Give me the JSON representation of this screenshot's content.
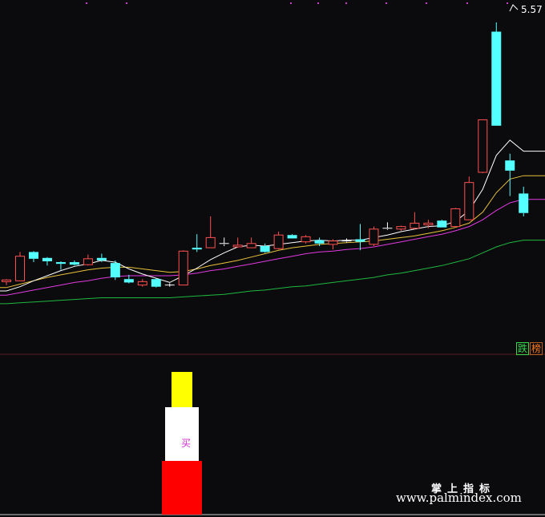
{
  "chart_data": {
    "type": "candlestick",
    "price_range": [
      2.05,
      5.72
    ],
    "high_label": "5.57",
    "candles": [
      {
        "o": 2.51,
        "c": 2.53,
        "h": 2.54,
        "l": 2.47
      },
      {
        "o": 2.52,
        "c": 2.81,
        "h": 2.86,
        "l": 2.52
      },
      {
        "o": 2.86,
        "c": 2.78,
        "h": 2.87,
        "l": 2.74
      },
      {
        "o": 2.79,
        "c": 2.75,
        "h": 2.8,
        "l": 2.7
      },
      {
        "o": 2.74,
        "c": 2.72,
        "h": 2.75,
        "l": 2.65
      },
      {
        "o": 2.74,
        "c": 2.71,
        "h": 2.76,
        "l": 2.7
      },
      {
        "o": 2.71,
        "c": 2.78,
        "h": 2.83,
        "l": 2.7
      },
      {
        "o": 2.79,
        "c": 2.76,
        "h": 2.84,
        "l": 2.74
      },
      {
        "o": 2.73,
        "c": 2.56,
        "h": 2.76,
        "l": 2.53
      },
      {
        "o": 2.54,
        "c": 2.5,
        "h": 2.59,
        "l": 2.49
      },
      {
        "o": 2.47,
        "c": 2.51,
        "h": 2.54,
        "l": 2.45
      },
      {
        "o": 2.54,
        "c": 2.45,
        "h": 2.55,
        "l": 2.44
      },
      {
        "o": 2.47,
        "c": 2.47,
        "h": 2.49,
        "l": 2.45
      },
      {
        "o": 2.47,
        "c": 2.87,
        "h": 2.88,
        "l": 2.47
      },
      {
        "o": 2.91,
        "c": 2.89,
        "h": 3.07,
        "l": 2.86
      },
      {
        "o": 2.91,
        "c": 3.03,
        "h": 3.28,
        "l": 2.91
      },
      {
        "o": 2.96,
        "c": 2.95,
        "h": 3.03,
        "l": 2.93
      },
      {
        "o": 2.92,
        "c": 2.94,
        "h": 3.03,
        "l": 2.91
      },
      {
        "o": 2.91,
        "c": 2.96,
        "h": 3.03,
        "l": 2.91
      },
      {
        "o": 2.93,
        "c": 2.86,
        "h": 2.96,
        "l": 2.85
      },
      {
        "o": 2.9,
        "c": 3.06,
        "h": 3.1,
        "l": 2.89
      },
      {
        "o": 3.06,
        "c": 3.02,
        "h": 3.07,
        "l": 3.02
      },
      {
        "o": 2.98,
        "c": 3.04,
        "h": 3.06,
        "l": 2.96
      },
      {
        "o": 3.0,
        "c": 2.96,
        "h": 3.03,
        "l": 2.93
      },
      {
        "o": 2.95,
        "c": 2.99,
        "h": 3.01,
        "l": 2.89
      },
      {
        "o": 2.98,
        "c": 2.99,
        "h": 3.02,
        "l": 2.97
      },
      {
        "o": 3.01,
        "c": 2.98,
        "h": 3.19,
        "l": 2.88
      },
      {
        "o": 2.95,
        "c": 3.13,
        "h": 3.16,
        "l": 2.93
      },
      {
        "o": 3.13,
        "c": 3.14,
        "h": 3.21,
        "l": 3.12
      },
      {
        "o": 3.13,
        "c": 3.16,
        "h": 3.17,
        "l": 3.11
      },
      {
        "o": 3.14,
        "c": 3.2,
        "h": 3.33,
        "l": 3.13
      },
      {
        "o": 3.18,
        "c": 3.2,
        "h": 3.24,
        "l": 3.14
      },
      {
        "o": 3.23,
        "c": 3.15,
        "h": 3.24,
        "l": 3.15
      },
      {
        "o": 3.16,
        "c": 3.37,
        "h": 3.38,
        "l": 3.15
      },
      {
        "o": 3.24,
        "c": 3.68,
        "h": 3.75,
        "l": 3.24
      },
      {
        "o": 3.8,
        "c": 4.42,
        "h": 4.42,
        "l": 3.79
      },
      {
        "o": 5.46,
        "c": 4.35,
        "h": 5.57,
        "l": 4.35
      },
      {
        "o": 3.94,
        "c": 3.82,
        "h": 4.02,
        "l": 3.52
      },
      {
        "o": 3.55,
        "c": 3.32,
        "h": 3.63,
        "l": 3.28
      }
    ],
    "ma_white": [
      2.4,
      2.45,
      2.52,
      2.58,
      2.64,
      2.69,
      2.72,
      2.76,
      2.74,
      2.66,
      2.6,
      2.55,
      2.5,
      2.58,
      2.67,
      2.77,
      2.85,
      2.92,
      2.94,
      2.93,
      2.95,
      2.97,
      2.99,
      3.0,
      2.99,
      3.0,
      3.0,
      3.03,
      3.06,
      3.1,
      3.13,
      3.16,
      3.17,
      3.22,
      3.35,
      3.6,
      4.0,
      4.18,
      4.05
    ],
    "ma_yellow": [
      2.44,
      2.48,
      2.52,
      2.56,
      2.59,
      2.62,
      2.65,
      2.67,
      2.68,
      2.68,
      2.66,
      2.64,
      2.62,
      2.63,
      2.66,
      2.7,
      2.73,
      2.76,
      2.8,
      2.84,
      2.88,
      2.91,
      2.93,
      2.95,
      2.96,
      2.97,
      2.98,
      2.99,
      3.01,
      3.03,
      3.05,
      3.08,
      3.11,
      3.15,
      3.2,
      3.33,
      3.56,
      3.72,
      3.76
    ],
    "ma_magenta": [
      2.35,
      2.38,
      2.41,
      2.44,
      2.47,
      2.5,
      2.52,
      2.55,
      2.57,
      2.58,
      2.58,
      2.58,
      2.58,
      2.59,
      2.61,
      2.64,
      2.66,
      2.69,
      2.72,
      2.75,
      2.78,
      2.81,
      2.84,
      2.86,
      2.87,
      2.89,
      2.9,
      2.92,
      2.95,
      2.98,
      3.01,
      3.04,
      3.07,
      3.11,
      3.16,
      3.24,
      3.35,
      3.44,
      3.48
    ],
    "ma_green": [
      2.25,
      2.26,
      2.27,
      2.28,
      2.29,
      2.3,
      2.31,
      2.32,
      2.32,
      2.32,
      2.32,
      2.32,
      2.32,
      2.33,
      2.34,
      2.35,
      2.36,
      2.38,
      2.4,
      2.41,
      2.43,
      2.45,
      2.46,
      2.48,
      2.5,
      2.52,
      2.54,
      2.56,
      2.59,
      2.61,
      2.64,
      2.67,
      2.7,
      2.74,
      2.78,
      2.85,
      2.92,
      2.97,
      3.0
    ]
  },
  "indicator": {
    "buy_label": "买",
    "bar_colors": [
      "#ff0000",
      "#ffffff",
      "#ffff00"
    ]
  },
  "tags": {
    "die": "跌",
    "bang": "榜"
  },
  "brand": {
    "cn": "掌上指标",
    "url": "www.palmindex.com"
  },
  "colors": {
    "up": "#ff5050",
    "down": "#54ffff",
    "doji": "#ffffff",
    "ma_white": "#ffffff",
    "ma_yellow": "#e8c23a",
    "ma_magenta": "#e23ae2",
    "ma_green": "#1fb83f"
  }
}
